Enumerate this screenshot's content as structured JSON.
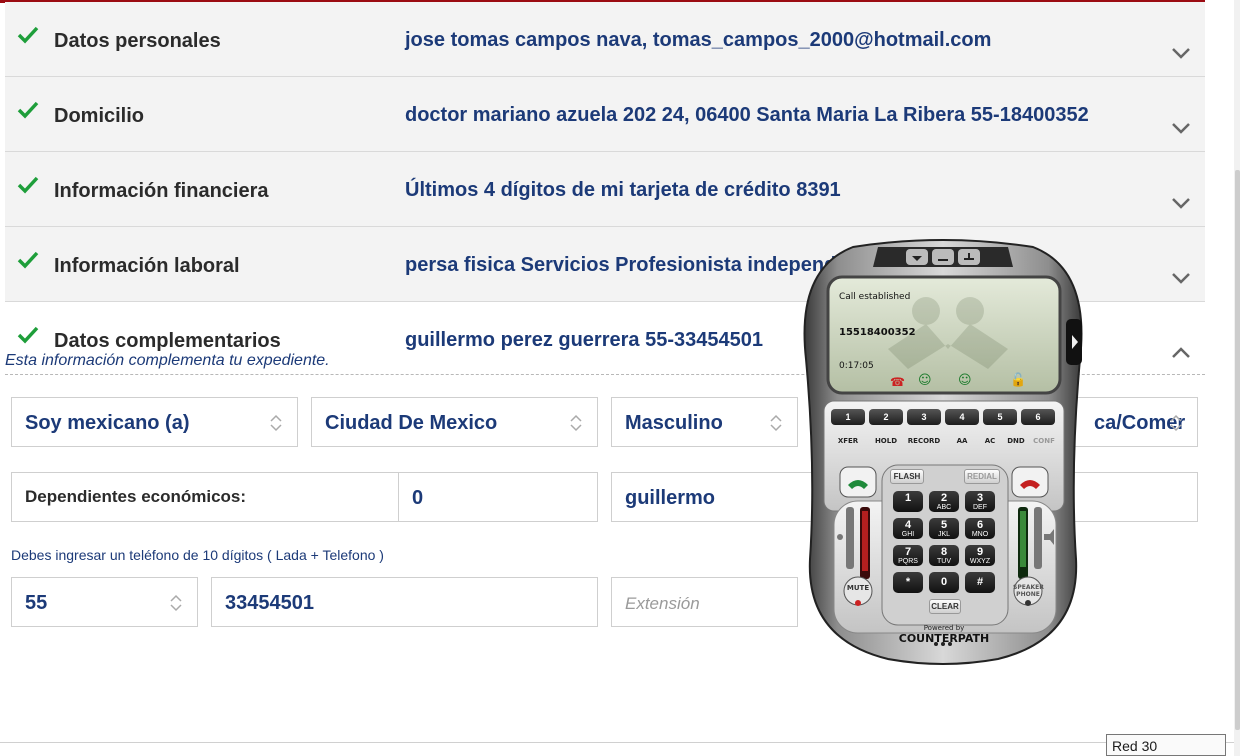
{
  "sections": [
    {
      "title": "Datos personales",
      "value": "jose tomas campos nava, tomas_campos_2000@hotmail.com"
    },
    {
      "title": "Domicilio",
      "value": "doctor mariano azuela 202 24, 06400 Santa Maria La Ribera 55-18400352"
    },
    {
      "title": "Información financiera",
      "value": "Últimos 4 dígitos de mi tarjeta de crédito 8391"
    },
    {
      "title": "Información laboral",
      "value": "persa fisica Servicios Profesionista independ"
    },
    {
      "title": "Datos complementarios",
      "value": "guillermo perez guerrera 55-33454501",
      "note": "Esta información complementa tu expediente."
    }
  ],
  "form": {
    "nationality": "Soy mexicano (a)",
    "city": "Ciudad De Mexico",
    "gender": "Masculino",
    "occupation_partial": "ca/Comer",
    "dependents_label": "Dependientes económicos:",
    "dependents_value": "0",
    "reference_name": "guillermo",
    "phone_hint": "Debes ingresar un teléfono de 10 dígitos ( Lada + Telefono )",
    "lada": "55",
    "phone": "33454501",
    "extension_placeholder": "Extensión"
  },
  "softphone": {
    "status": "Call established",
    "number": "15518400352",
    "timer": "0:17:05",
    "line_keys": [
      "1",
      "2",
      "3",
      "4",
      "5",
      "6"
    ],
    "function_keys": [
      "XFER",
      "HOLD",
      "RECORD",
      "AA",
      "AC",
      "DND",
      "CONF"
    ],
    "flash_label": "FLASH",
    "redial_label": "REDIAL",
    "keypad": [
      {
        "digit": "1",
        "letters": ""
      },
      {
        "digit": "2",
        "letters": "ABC"
      },
      {
        "digit": "3",
        "letters": "DEF"
      },
      {
        "digit": "4",
        "letters": "GHI"
      },
      {
        "digit": "5",
        "letters": "JKL"
      },
      {
        "digit": "6",
        "letters": "MNO"
      },
      {
        "digit": "7",
        "letters": "PQRS"
      },
      {
        "digit": "8",
        "letters": "TUV"
      },
      {
        "digit": "9",
        "letters": "WXYZ"
      },
      {
        "digit": "*",
        "letters": ""
      },
      {
        "digit": "0",
        "letters": ""
      },
      {
        "digit": "#",
        "letters": ""
      }
    ],
    "clear_label": "CLEAR",
    "mute_label": "MUTE",
    "speaker_label": "SPEAKER PHONE",
    "powered_by": "Powered by",
    "brand": "COUNTERPATH"
  },
  "statusbar": {
    "text": "Red  30"
  },
  "colors": {
    "accent": "#1c3a78",
    "check": "#1e9e3a",
    "top_border": "#9b0b12"
  }
}
